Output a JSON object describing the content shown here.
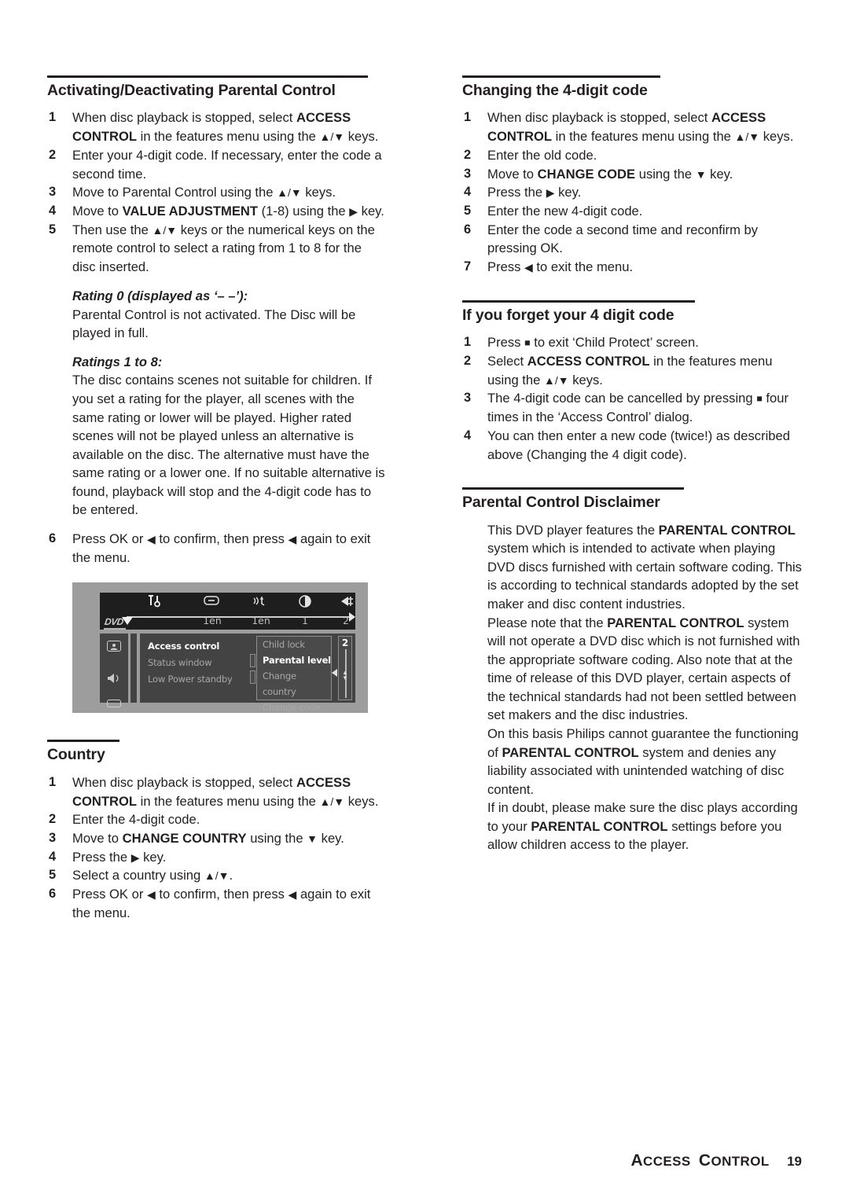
{
  "page": {
    "number": "19",
    "footer_title": "ACCESS CONTROL"
  },
  "left_column": {
    "section1": {
      "heading": "Activating/Deactivating Parental Control",
      "steps": [
        "When disc playback is stopped, select ACCESS CONTROL in the features menu using the ▲/▼ keys.",
        "Enter your 4-digit code. If necessary, enter the code a second time.",
        "Move to Parental Control using the ▲/▼ keys.",
        "Move to VALUE ADJUSTMENT (1-8) using the ▶ key.",
        "Then use the ▲/▼ keys or the numerical keys on the remote control to select a rating from 1 to 8 for the disc inserted.",
        "Press OK or ◀ to confirm, then press ◀ again to exit the menu."
      ],
      "note1_heading": "Rating 0 (displayed as ‘– –’):",
      "note1_body": "Parental Control is not activated. The Disc will be played in full.",
      "note2_heading": "Ratings 1 to 8:",
      "note2_body": "The disc contains scenes not suitable for children. If you set a rating for the player, all scenes with the same rating or lower will be played. Higher rated scenes will not be played unless an alternative is available on the disc. The alternative must have the same rating or a lower one. If no suitable alternative is found, playback will stop and the 4-digit code has to be entered."
    },
    "tv_figure": {
      "disc_logo": "DVD",
      "top_icons": [
        "settings-tools-icon",
        "subtitle-icon",
        "audio-language-icon",
        "camera-angle-icon",
        "exit-icon"
      ],
      "top_labels": [
        "1en",
        "1en",
        "1",
        "2"
      ],
      "side_icons": [
        "display-person-icon",
        "speaker-icon"
      ],
      "menu_items": [
        {
          "label": "Access control",
          "selected": true
        },
        {
          "label": "Status window",
          "selected": false
        },
        {
          "label": "Low Power standby",
          "selected": false
        }
      ],
      "submenu_items": [
        {
          "label": "Child lock",
          "selected": false
        },
        {
          "label": "Parental level",
          "selected": true
        },
        {
          "label": "Change country",
          "selected": false
        },
        {
          "label": "Change code",
          "selected": false
        }
      ],
      "value": "2"
    },
    "section2": {
      "heading": "Country",
      "steps": [
        "When disc playback is stopped, select ACCESS CONTROL in the features menu using the ▲/▼ keys.",
        "Enter the 4-digit code.",
        "Move to CHANGE COUNTRY using the ▼ key.",
        "Press the ▶ key.",
        "Select a country using ▲/▼.",
        "Press OK or ◀ to confirm, then press ◀ again to exit the menu."
      ]
    }
  },
  "right_column": {
    "section1": {
      "heading": "Changing the 4-digit code",
      "steps": [
        "When disc playback is stopped, select ACCESS CONTROL in the features menu using the ▲/▼ keys.",
        "Enter the old code.",
        "Move to CHANGE CODE using the ▼ key.",
        "Press the ▶ key.",
        "Enter the new 4-digit code.",
        "Enter the code a second time and reconfirm by pressing OK.",
        "Press ◀ to exit the menu."
      ]
    },
    "section2": {
      "heading": "If you forget your 4 digit code",
      "steps": [
        "Press ■ to exit ‘Child Protect’ screen.",
        "Select ACCESS CONTROL in the features menu using the ▲/▼ keys.",
        "The 4-digit code can be cancelled by pressing ■ four times in the ‘Access Control’ dialog.",
        "You can then enter a new code (twice!) as described above (Changing the 4 digit code)."
      ]
    },
    "section3": {
      "heading": "Parental Control Disclaimer",
      "paragraphs": [
        "This DVD player features the PARENTAL CONTROL system which is intended to activate when playing DVD discs furnished with certain software coding. This is according to technical standards adopted by the set maker and disc content industries.",
        "Please note that the PARENTAL CONTROL system will not operate a DVD disc which is not furnished with the appropriate software coding. Also note that at the time of release of this DVD player, certain aspects of the technical standards had not been settled between set makers and the disc industries.",
        "On this basis Philips cannot guarantee the functioning of PARENTAL CONTROL system and denies any liability associated with unintended watching of disc content.",
        "If in doubt, please make sure the disc plays according to your PARENTAL CONTROL settings before you allow children access to the player."
      ]
    }
  }
}
